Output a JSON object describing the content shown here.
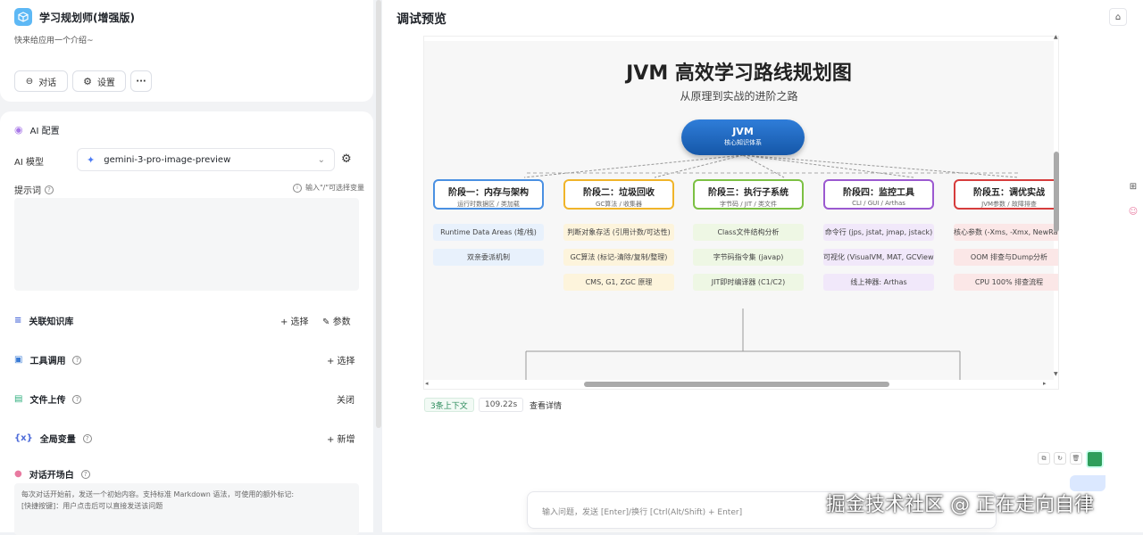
{
  "app": {
    "title": "学习规划师(增强版)",
    "description": "快来给应用一个介绍~"
  },
  "toolbar": {
    "chat_label": "对话",
    "settings_label": "设置",
    "more_label": "···"
  },
  "ai_config": {
    "section_title": "AI 配置",
    "model_label": "AI 模型",
    "model_value": "gemini-3-pro-image-preview",
    "prompt_label": "提示词",
    "prompt_hint": "输入\"/\"可选择变量"
  },
  "knowledge": {
    "label": "关联知识库",
    "select": "+ 选择",
    "params": "参数"
  },
  "tools": {
    "label": "工具调用",
    "select": "+ 选择"
  },
  "upload": {
    "label": "文件上传",
    "value": "关闭"
  },
  "variables": {
    "label": "全局变量",
    "add": "+ 新增"
  },
  "opener": {
    "label": "对话开场白",
    "line1": "每次对话开始前，发送一个初始内容。支持标准 Markdown 语法，可使用的额外标记:",
    "line2": "[快捷按键]：用户点击后可以直接发送该问题"
  },
  "preview": {
    "title": "调试预览",
    "lock_icon": "lock-icon",
    "context_badge": "3条上下文",
    "time_badge": "109.22s",
    "detail_link": "查看详情",
    "input_placeholder": "输入问题，发送 [Enter]/换行 [Ctrl(Alt/Shift) + Enter]",
    "watermark": "掘金技术社区 @ 正在走向自律"
  },
  "infographic": {
    "title": "JVM 高效学习路线规划图",
    "subtitle": "从原理到实战的进阶之路",
    "root_title": "JVM",
    "root_sub": "核心知识体系",
    "stages": [
      {
        "title": "阶段一：内存与架构",
        "sub": "运行时数据区 / 类加载",
        "color": "#4a90e2",
        "fill": "#e8f1fc",
        "items": [
          "Runtime Data Areas (堆/栈)",
          "双亲委派机制"
        ]
      },
      {
        "title": "阶段二：垃圾回收",
        "sub": "GC算法 / 收集器",
        "color": "#f0b429",
        "fill": "#fdf4dc",
        "items": [
          "判断对象存活 (引用计数/可达性)",
          "GC算法 (标记-清除/复制/整理)",
          "CMS, G1, ZGC 原理"
        ]
      },
      {
        "title": "阶段三：执行子系统",
        "sub": "字节码 / JIT / 类文件",
        "color": "#7cc043",
        "fill": "#eef7e4",
        "items": [
          "Class文件结构分析",
          "字节码指令集 (javap)",
          "JIT即时编译器 (C1/C2)"
        ]
      },
      {
        "title": "阶段四：监控工具",
        "sub": "CLI / GUI / Arthas",
        "color": "#9b59d0",
        "fill": "#f1e8fa",
        "items": [
          "命令行 (jps, jstat, jmap, jstack)",
          "可视化 (VisualVM, MAT, GCView)",
          "线上神器: Arthas"
        ]
      },
      {
        "title": "阶段五：调优实战",
        "sub": "JVM参数 / 故障排查",
        "color": "#d63c3c",
        "fill": "#fbe7e7",
        "items": [
          "核心参数 (-Xms, -Xmx, NewRatio)",
          "OOM 排查与Dump分析",
          "CPU 100% 排查流程"
        ]
      }
    ]
  }
}
